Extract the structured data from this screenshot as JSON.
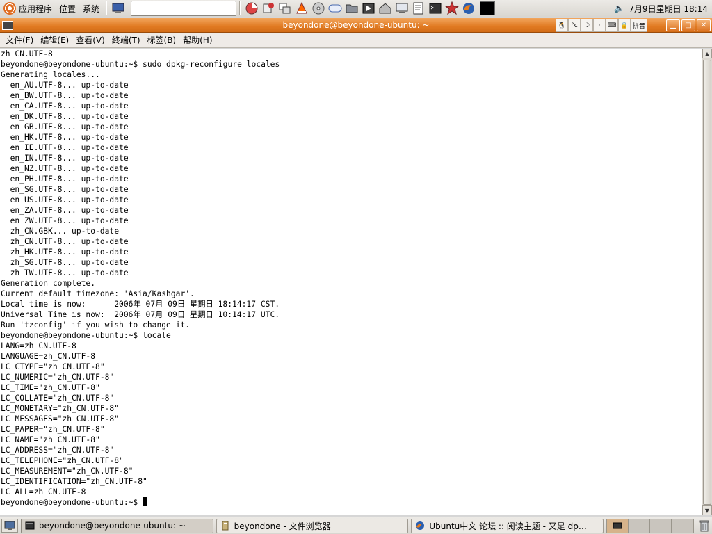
{
  "top_panel": {
    "menus": [
      "应用程序",
      "位置",
      "系统"
    ],
    "launchers": [
      "screen-icon",
      "pie-chart-icon",
      "paint-icon",
      "photos-icon",
      "vlc-icon",
      "dvd-icon",
      "mplayer-icon",
      "folder-icon",
      "media-icon",
      "home-icon",
      "monitor-icon",
      "text-editor-icon",
      "terminal-icon",
      "star-icon",
      "firefox-icon"
    ],
    "clock": "7月9日星期日 18:14"
  },
  "window": {
    "title": "beyondone@beyondone-ubuntu: ~",
    "ime_icons": [
      "tux-icon",
      "ime-mode-icon",
      "moon-icon",
      "dot-icon",
      "keyboard-icon",
      "lock-icon",
      "pinyin-icon"
    ],
    "ime_pinyin_label": "拼音"
  },
  "menubar": {
    "items": [
      "文件(F)",
      "编辑(E)",
      "查看(V)",
      "终端(T)",
      "标签(B)",
      "帮助(H)"
    ]
  },
  "terminal": {
    "lines": [
      "zh_CN.UTF-8",
      "beyondone@beyondone-ubuntu:~$ sudo dpkg-reconfigure locales",
      "Generating locales...",
      "  en_AU.UTF-8... up-to-date",
      "  en_BW.UTF-8... up-to-date",
      "  en_CA.UTF-8... up-to-date",
      "  en_DK.UTF-8... up-to-date",
      "  en_GB.UTF-8... up-to-date",
      "  en_HK.UTF-8... up-to-date",
      "  en_IE.UTF-8... up-to-date",
      "  en_IN.UTF-8... up-to-date",
      "  en_NZ.UTF-8... up-to-date",
      "  en_PH.UTF-8... up-to-date",
      "  en_SG.UTF-8... up-to-date",
      "  en_US.UTF-8... up-to-date",
      "  en_ZA.UTF-8... up-to-date",
      "  en_ZW.UTF-8... up-to-date",
      "  zh_CN.GBK... up-to-date",
      "  zh_CN.UTF-8... up-to-date",
      "  zh_HK.UTF-8... up-to-date",
      "  zh_SG.UTF-8... up-to-date",
      "  zh_TW.UTF-8... up-to-date",
      "Generation complete.",
      "Current default timezone: 'Asia/Kashgar'.",
      "Local time is now:      2006年 07月 09日 星期日 18:14:17 CST.",
      "Universal Time is now:  2006年 07月 09日 星期日 10:14:17 UTC.",
      "Run 'tzconfig' if you wish to change it.",
      "beyondone@beyondone-ubuntu:~$ locale",
      "LANG=zh_CN.UTF-8",
      "LANGUAGE=zh_CN.UTF-8",
      "LC_CTYPE=\"zh_CN.UTF-8\"",
      "LC_NUMERIC=\"zh_CN.UTF-8\"",
      "LC_TIME=\"zh_CN.UTF-8\"",
      "LC_COLLATE=\"zh_CN.UTF-8\"",
      "LC_MONETARY=\"zh_CN.UTF-8\"",
      "LC_MESSAGES=\"zh_CN.UTF-8\"",
      "LC_PAPER=\"zh_CN.UTF-8\"",
      "LC_NAME=\"zh_CN.UTF-8\"",
      "LC_ADDRESS=\"zh_CN.UTF-8\"",
      "LC_TELEPHONE=\"zh_CN.UTF-8\"",
      "LC_MEASUREMENT=\"zh_CN.UTF-8\"",
      "LC_IDENTIFICATION=\"zh_CN.UTF-8\"",
      "LC_ALL=zh_CN.UTF-8"
    ],
    "prompt": "beyondone@beyondone-ubuntu:~$ "
  },
  "taskbar": {
    "tasks": [
      {
        "label": "beyondone@beyondone-ubuntu: ~",
        "icon": "terminal-icon",
        "active": true
      },
      {
        "label": "beyondone - 文件浏览器",
        "icon": "file-browser-icon",
        "active": false
      },
      {
        "label": "Ubuntu中文 论坛 :: 阅读主题 - 又是 dp…",
        "icon": "firefox-icon",
        "active": false
      }
    ],
    "workspaces": 4,
    "current_workspace": 1
  },
  "colors": {
    "titlebar_accent": "#e17a22",
    "terminal_bg": "#ffffff",
    "terminal_fg": "#000000"
  }
}
